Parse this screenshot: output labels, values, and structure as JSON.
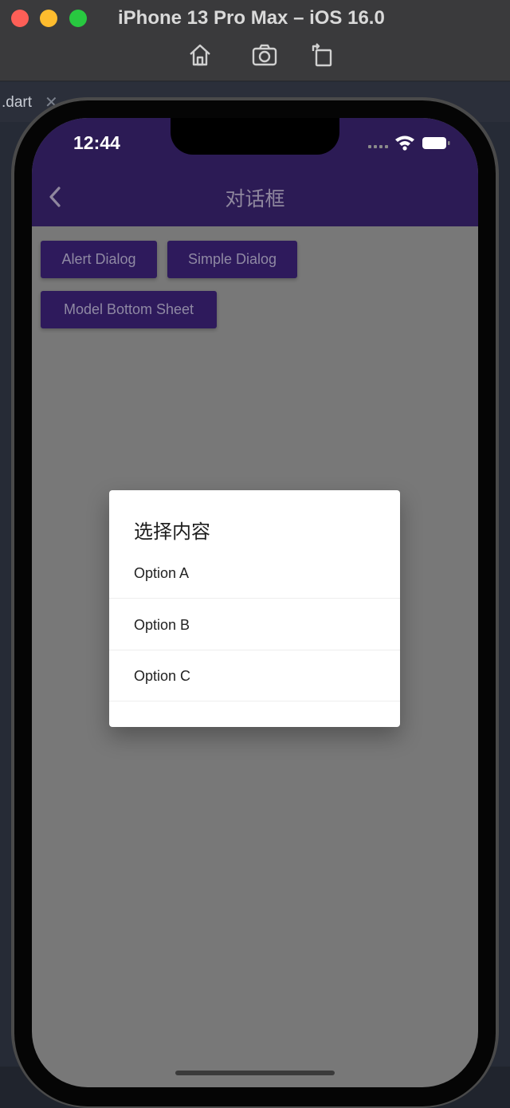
{
  "simulator": {
    "title": "iPhone 13 Pro Max – iOS 16.0",
    "tools": [
      "home-icon",
      "screenshot-icon",
      "rotate-icon"
    ]
  },
  "ide": {
    "tab_label": ".dart",
    "tab_close": "✕"
  },
  "status_bar": {
    "time": "12:44"
  },
  "app_bar": {
    "title": "对话框",
    "background": "#2c1b55"
  },
  "buttons": {
    "alert_dialog": "Alert Dialog",
    "simple_dialog": "Simple Dialog",
    "modal_bottom_sheet": "Model Bottom Sheet"
  },
  "dialog": {
    "title": "选择内容",
    "options": [
      "Option A",
      "Option B",
      "Option C"
    ]
  }
}
